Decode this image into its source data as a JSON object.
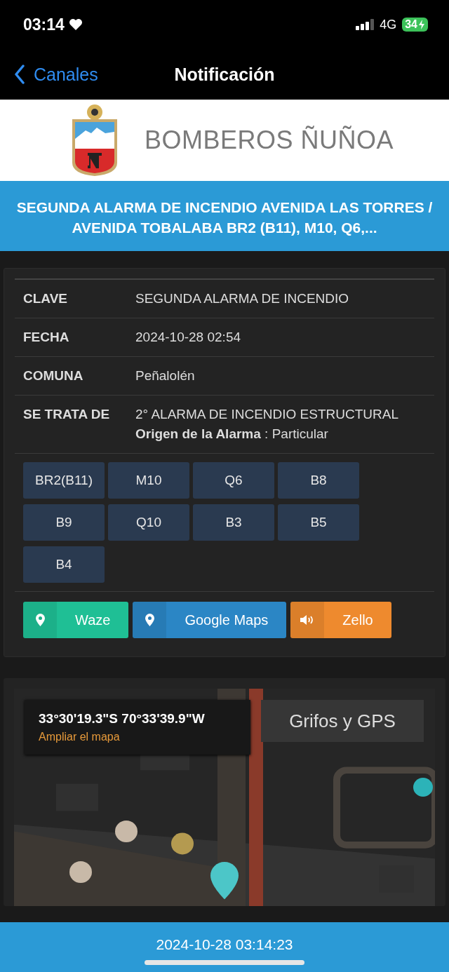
{
  "status_bar": {
    "time": "03:14",
    "network": "4G",
    "battery": "34"
  },
  "nav": {
    "back": "Canales",
    "title": "Notificación"
  },
  "header": {
    "org": "BOMBEROS ÑUÑOA"
  },
  "alert_title": "SEGUNDA ALARMA DE INCENDIO AVENIDA LAS TORRES / AVENIDA TOBALABA BR2 (B11), M10, Q6,...",
  "details": [
    {
      "label": "CLAVE",
      "value": "SEGUNDA ALARMA DE INCENDIO"
    },
    {
      "label": "FECHA",
      "value": "2024-10-28 02:54"
    },
    {
      "label": "COMUNA",
      "value": "Peñalolén"
    },
    {
      "label": "SE TRATA DE",
      "value": "2° ALARMA DE INCENDIO ESTRUCTURAL",
      "extra": "**Origen de la Alarma** : Particular"
    }
  ],
  "units": [
    "BR2(B11)",
    "M10",
    "Q6",
    "B8",
    "B9",
    "Q10",
    "B3",
    "B5",
    "B4"
  ],
  "actions": [
    {
      "kind": "waze",
      "label": "Waze",
      "color": "#1fbf95"
    },
    {
      "kind": "maps",
      "label": "Google Maps",
      "color": "#2b86c5"
    },
    {
      "kind": "zello",
      "label": "Zello",
      "color": "#ee8a2e"
    }
  ],
  "map": {
    "coordinates": "33°30'19.3\"S 70°33'39.9\"W",
    "link": "Ampliar el mapa",
    "button": "Grifos y GPS"
  },
  "footer": {
    "timestamp": "2024-10-28 03:14:23"
  }
}
